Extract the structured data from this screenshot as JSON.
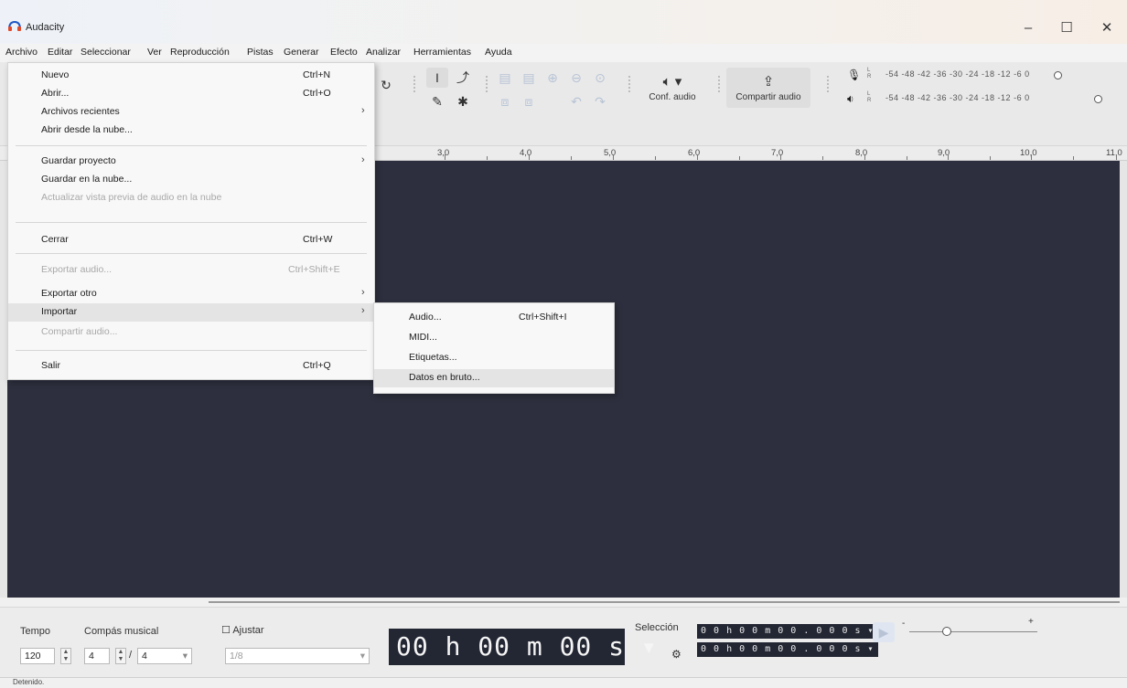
{
  "window": {
    "title": "Audacity"
  },
  "menubar": [
    "Archivo",
    "Editar",
    "Seleccionar",
    "Ver",
    "Reproducción",
    "Pistas",
    "Generar",
    "Efecto",
    "Analizar",
    "Herramientas",
    "Ayuda"
  ],
  "file_menu": [
    {
      "label": "Nuevo",
      "shortcut": "Ctrl+N"
    },
    {
      "label": "Abrir...",
      "shortcut": "Ctrl+O"
    },
    {
      "label": "Archivos recientes",
      "submenu": true
    },
    {
      "label": "Abrir desde la nube..."
    },
    {
      "label": "Guardar proyecto",
      "submenu": true
    },
    {
      "label": "Guardar en la nube..."
    },
    {
      "label": "Actualizar vista previa de audio en la nube",
      "disabled": true
    },
    {
      "label": "Cerrar",
      "shortcut": "Ctrl+W"
    },
    {
      "label": "Exportar audio...",
      "shortcut": "Ctrl+Shift+E",
      "disabled": true
    },
    {
      "label": "Exportar otro",
      "submenu": true
    },
    {
      "label": "Importar",
      "submenu": true,
      "highlighted": true
    },
    {
      "label": "Compartir audio...",
      "disabled": true
    },
    {
      "label": "Salir",
      "shortcut": "Ctrl+Q"
    }
  ],
  "import_submenu": [
    {
      "label": "Audio...",
      "shortcut": "Ctrl+Shift+I"
    },
    {
      "label": "MIDI..."
    },
    {
      "label": "Etiquetas..."
    },
    {
      "label": "Datos en bruto...",
      "highlighted": true
    }
  ],
  "toolbar": {
    "audio_setup_label": "Conf. audio",
    "share_audio_label": "Compartir audio",
    "meter_ticks_record": "-54 -48 -42 -36 -30 -24 -18 -12 -6 0",
    "meter_ticks_play": "-54 -48 -42 -36 -30 -24 -18 -12 -6 0",
    "meter_channels": [
      "L",
      "R"
    ]
  },
  "ruler": {
    "labels": [
      "3,0",
      "4,0",
      "5,0",
      "6,0",
      "7,0",
      "8,0",
      "9,0",
      "10,0",
      "11,0"
    ]
  },
  "bottom": {
    "tempo_label": "Tempo",
    "tempo_value": "120",
    "time_sig_label": "Compás musical",
    "time_sig_num": "4",
    "time_sig_den": "4",
    "snap_label": "Ajustar",
    "snap_value": "1/8",
    "time_display": "00 h 00 m 00 s",
    "selection_label": "Selección",
    "selection_start": "0 0 h 0 0 m 0 0 . 0 0 0 s",
    "selection_end": "0 0 h 0 0 m 0 0 . 0 0 0 s"
  },
  "status": {
    "text": "Detenido."
  },
  "colors": {
    "track_bg": "#2d2f3e",
    "time_display_bg": "#232734",
    "menu_highlight": "#e4e4e4"
  }
}
